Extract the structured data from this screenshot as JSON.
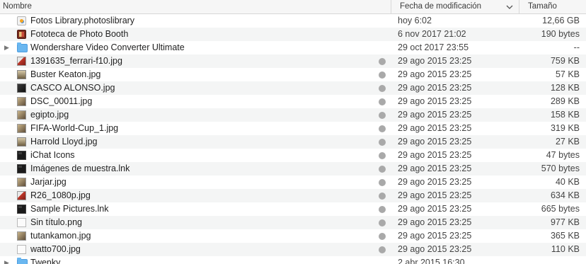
{
  "header": {
    "name_label": "Nombre",
    "date_label": "Fecha de modificación",
    "size_label": "Tamaño",
    "sort_icon": "chevron-down-icon"
  },
  "rows": [
    {
      "name": "Fotos Library.photoslibrary",
      "date": "hoy 6:02",
      "size": "12,66 GB",
      "icon": "photos-library-icon",
      "icon_class": "icon-library",
      "folder": false,
      "synced": false
    },
    {
      "name": "Fototeca de Photo Booth",
      "date": "6 nov 2017 21:02",
      "size": "190 bytes",
      "icon": "photo-booth-library-icon",
      "icon_class": "icon-pbooth",
      "folder": false,
      "synced": false
    },
    {
      "name": "Wondershare Video Converter Ultimate",
      "date": "29 oct 2017 23:55",
      "size": "--",
      "icon": "folder-icon",
      "icon_class": "icon-folder",
      "folder": true,
      "synced": false
    },
    {
      "name": "1391635_ferrari-f10.jpg",
      "date": "29 ago 2015 23:25",
      "size": "759 KB",
      "icon": "image-file-icon",
      "icon_class": "icon-image-red",
      "folder": false,
      "synced": true
    },
    {
      "name": "Buster Keaton.jpg",
      "date": "29 ago 2015 23:25",
      "size": "57 KB",
      "icon": "image-file-icon",
      "icon_class": "icon-image-portrait",
      "folder": false,
      "synced": true
    },
    {
      "name": "CASCO ALONSO.jpg",
      "date": "29 ago 2015 23:25",
      "size": "128 KB",
      "icon": "image-file-icon",
      "icon_class": "icon-image-dark",
      "folder": false,
      "synced": true
    },
    {
      "name": "DSC_00011.jpg",
      "date": "29 ago 2015 23:25",
      "size": "289 KB",
      "icon": "image-file-icon",
      "icon_class": "icon-image",
      "folder": false,
      "synced": true
    },
    {
      "name": "egipto.jpg",
      "date": "29 ago 2015 23:25",
      "size": "158 KB",
      "icon": "image-file-icon",
      "icon_class": "icon-image",
      "folder": false,
      "synced": true
    },
    {
      "name": "FIFA-World-Cup_1.jpg",
      "date": "29 ago 2015 23:25",
      "size": "319 KB",
      "icon": "image-file-icon",
      "icon_class": "icon-image",
      "folder": false,
      "synced": true
    },
    {
      "name": "Harrold Lloyd.jpg",
      "date": "29 ago 2015 23:25",
      "size": "27 KB",
      "icon": "image-file-icon",
      "icon_class": "icon-image-portrait",
      "folder": false,
      "synced": true
    },
    {
      "name": "iChat Icons",
      "date": "29 ago 2015 23:25",
      "size": "47 bytes",
      "icon": "alias-icon",
      "icon_class": "icon-alias",
      "folder": false,
      "synced": true
    },
    {
      "name": "Imágenes de muestra.lnk",
      "date": "29 ago 2015 23:25",
      "size": "570 bytes",
      "icon": "alias-icon",
      "icon_class": "icon-alias",
      "folder": false,
      "synced": true
    },
    {
      "name": "Jarjar.jpg",
      "date": "29 ago 2015 23:25",
      "size": "40 KB",
      "icon": "image-file-icon",
      "icon_class": "icon-image",
      "folder": false,
      "synced": true
    },
    {
      "name": "R26_1080p.jpg",
      "date": "29 ago 2015 23:25",
      "size": "634 KB",
      "icon": "image-file-icon",
      "icon_class": "icon-image-red",
      "folder": false,
      "synced": true
    },
    {
      "name": "Sample Pictures.lnk",
      "date": "29 ago 2015 23:25",
      "size": "665 bytes",
      "icon": "alias-icon",
      "icon_class": "icon-alias",
      "folder": false,
      "synced": true
    },
    {
      "name": "Sin título.png",
      "date": "29 ago 2015 23:25",
      "size": "977 KB",
      "icon": "image-file-icon",
      "icon_class": "icon-blank",
      "folder": false,
      "synced": true
    },
    {
      "name": "tutankamon.jpg",
      "date": "29 ago 2015 23:25",
      "size": "365 KB",
      "icon": "image-file-icon",
      "icon_class": "icon-image",
      "folder": false,
      "synced": true
    },
    {
      "name": "watto700.jpg",
      "date": "29 ago 2015 23:25",
      "size": "110 KB",
      "icon": "image-file-icon",
      "icon_class": "icon-blank",
      "folder": false,
      "synced": true
    },
    {
      "name": "Twenky",
      "date": "2 abr 2015 16:30",
      "size": "",
      "icon": "folder-icon",
      "icon_class": "icon-folder",
      "folder": true,
      "synced": false
    }
  ],
  "colors": {
    "header_bg": "#f6f6f6",
    "alt_row_bg": "#f4f5f5",
    "folder_blue": "#6ab7f0",
    "sync_dot": "#a9a9a9"
  }
}
